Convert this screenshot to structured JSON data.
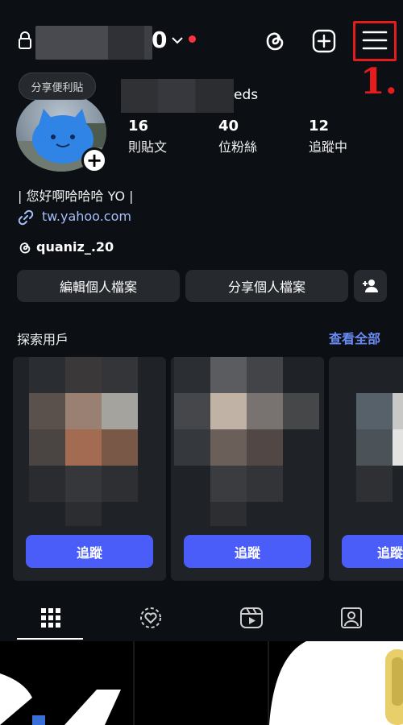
{
  "header": {
    "username_visible": "0",
    "annotation": "1."
  },
  "profile": {
    "note": "分享便利貼",
    "name_visible": "eds",
    "stats": [
      {
        "value": "16",
        "label": "則貼文"
      },
      {
        "value": "40",
        "label": "位粉絲"
      },
      {
        "value": "12",
        "label": "追蹤中"
      }
    ],
    "bio": "| 您好啊哈哈哈 YO |",
    "link": "tw.yahoo.com",
    "threads_handle": "quaniz_.20"
  },
  "actions": {
    "edit_profile": "編輯個人檔案",
    "share_profile": "分享個人檔案"
  },
  "discover": {
    "title": "探索用戶",
    "see_all": "查看全部",
    "follow_label": "追蹤"
  },
  "tabs": [
    "posts-grid",
    "tagged",
    "reels",
    "mentions"
  ],
  "colors": {
    "background": "#0c1014",
    "accent": "#4a5df9",
    "link": "#a5bdf8",
    "annotation": "#e41c1c",
    "notification_dot": "#ff3040"
  }
}
